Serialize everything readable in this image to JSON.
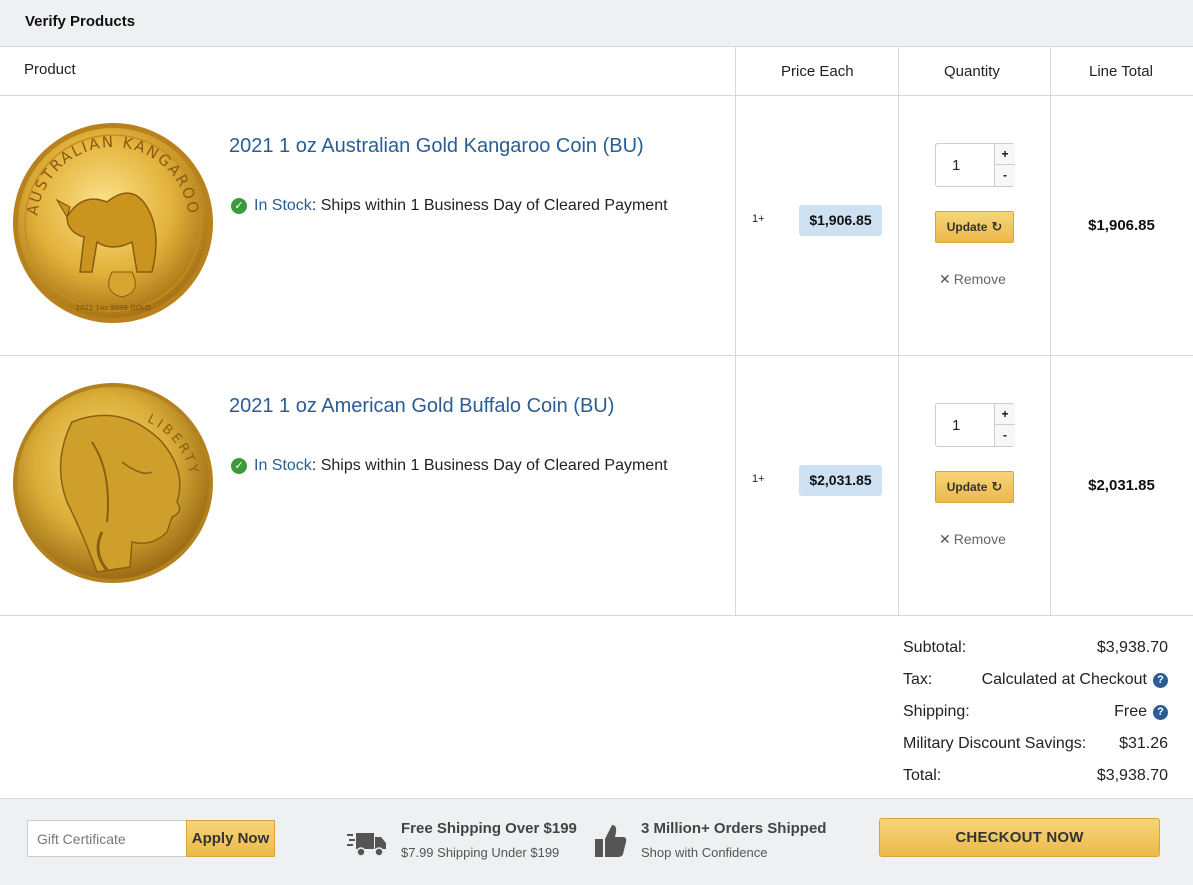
{
  "header": {
    "title": "Verify Products"
  },
  "columns": {
    "product": "Product",
    "price_each": "Price Each",
    "quantity": "Quantity",
    "line_total": "Line Total"
  },
  "items": [
    {
      "name": "2021 1 oz Australian Gold Kangaroo Coin (BU)",
      "stock_label": "In Stock",
      "stock_detail": ": Ships within 1 Business Day of Cleared Payment",
      "tier": "1+",
      "price": "$1,906.85",
      "quantity": "1",
      "plus": "+",
      "minus": "-",
      "update_label": "Update",
      "remove_label": "Remove",
      "line_total": "$1,906.85",
      "coin_text_top": "AUSTRALIAN KANGAROO",
      "coin_text_bottom": "2021 1oz 9999 GOLD"
    },
    {
      "name": "2021 1 oz American Gold Buffalo Coin (BU)",
      "stock_label": "In Stock",
      "stock_detail": ": Ships within 1 Business Day of Cleared Payment",
      "tier": "1+",
      "price": "$2,031.85",
      "quantity": "1",
      "plus": "+",
      "minus": "-",
      "update_label": "Update",
      "remove_label": "Remove",
      "line_total": "$2,031.85",
      "coin_text_top": "LIBERTY"
    }
  ],
  "summary": {
    "subtotal_label": "Subtotal:",
    "subtotal_value": "$3,938.70",
    "tax_label": "Tax:",
    "tax_value": "Calculated at Checkout",
    "shipping_label": "Shipping:",
    "shipping_value": "Free",
    "discount_label": "Military Discount Savings:",
    "discount_value": "$31.26",
    "total_label": "Total:",
    "total_value": "$3,938.70"
  },
  "footer": {
    "gift_placeholder": "Gift Certificate",
    "apply_label": "Apply Now",
    "promo1_title": "Free Shipping Over $199",
    "promo1_sub": "$7.99 Shipping Under $199",
    "promo2_title": "3 Million+ Orders Shipped",
    "promo2_sub": "Shop with Confidence",
    "checkout_label": "CHECKOUT NOW"
  },
  "icons": {
    "truck": "truck-icon",
    "thumbs_up": "thumbs-up-icon",
    "check": "check-circle-icon",
    "help": "question-circle-icon",
    "refresh": "refresh-icon",
    "remove": "x-icon"
  },
  "colors": {
    "link_blue": "#2a5d94",
    "price_badge": "#cde1f3",
    "button_gold": "#eab94a",
    "stock_green": "#3c9a3c",
    "header_gray": "#eef0f2"
  }
}
